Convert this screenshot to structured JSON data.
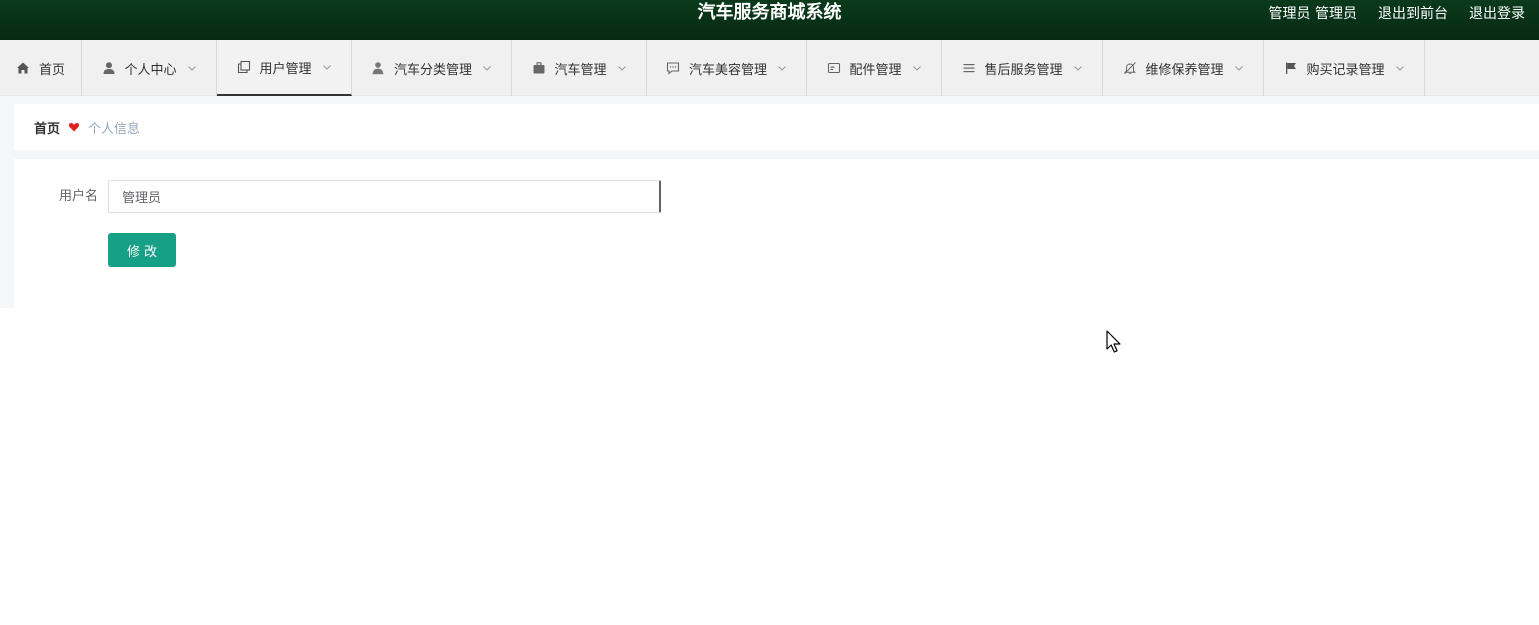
{
  "header": {
    "title": "汽车服务商城系统",
    "user_label": "管理员 管理员",
    "to_front_link": "退出到前台",
    "logout_link": "退出登录",
    "background_color": "#062a12"
  },
  "nav": {
    "items": [
      {
        "label": "首页",
        "icon": "home-icon",
        "has_dropdown": false,
        "active": false
      },
      {
        "label": "个人中心",
        "icon": "user-icon",
        "has_dropdown": true,
        "active": false
      },
      {
        "label": "用户管理",
        "icon": "copy-icon",
        "has_dropdown": true,
        "active": true
      },
      {
        "label": "汽车分类管理",
        "icon": "person-icon",
        "has_dropdown": true,
        "active": false
      },
      {
        "label": "汽车管理",
        "icon": "briefcase-icon",
        "has_dropdown": true,
        "active": false
      },
      {
        "label": "汽车美容管理",
        "icon": "chat-icon",
        "has_dropdown": true,
        "active": false
      },
      {
        "label": "配件管理",
        "icon": "card-icon",
        "has_dropdown": true,
        "active": false
      },
      {
        "label": "售后服务管理",
        "icon": "list-icon",
        "has_dropdown": true,
        "active": false
      },
      {
        "label": "维修保养管理",
        "icon": "bell-off-icon",
        "has_dropdown": true,
        "active": false
      },
      {
        "label": "购买记录管理",
        "icon": "flag-icon",
        "has_dropdown": true,
        "active": false
      }
    ]
  },
  "breadcrumb": {
    "home": "首页",
    "separator_icon": "heart-icon",
    "current": "个人信息",
    "separator_color": "#e02020"
  },
  "form": {
    "username_label": "用户名",
    "username_value": "管理员",
    "submit_label": "修改",
    "button_color": "#16a085"
  }
}
